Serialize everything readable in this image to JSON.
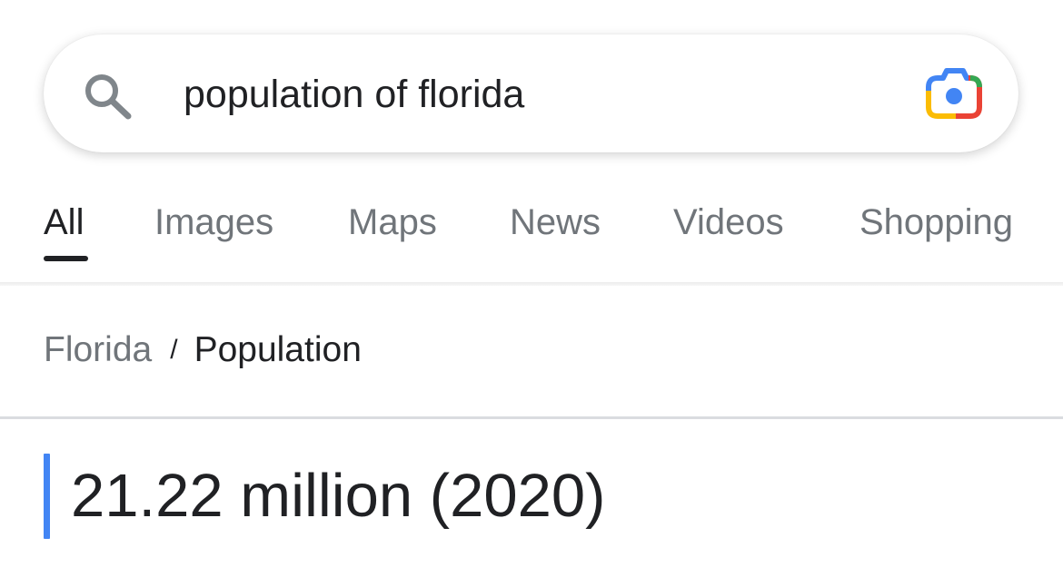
{
  "search": {
    "query": "population of florida",
    "search_icon": "search-icon",
    "lens_icon": "google-lens-icon"
  },
  "tabs": [
    {
      "label": "All",
      "active": true
    },
    {
      "label": "Images",
      "active": false
    },
    {
      "label": "Maps",
      "active": false
    },
    {
      "label": "News",
      "active": false
    },
    {
      "label": "Videos",
      "active": false
    },
    {
      "label": "Shopping",
      "active": false
    }
  ],
  "breadcrumb": {
    "parent": "Florida",
    "separator": "/",
    "current": "Population"
  },
  "answer": {
    "value": "21.22 million (2020)"
  },
  "colors": {
    "text_primary": "#202124",
    "text_secondary": "#70757a",
    "accent_blue": "#4285f4",
    "lens_blue": "#4285f4",
    "lens_red": "#ea4335",
    "lens_yellow": "#fbbc04",
    "lens_green": "#34a853"
  }
}
